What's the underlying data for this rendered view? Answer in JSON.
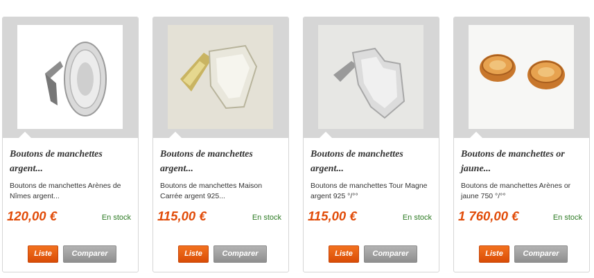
{
  "products": [
    {
      "title": "Boutons de manchettes argent...",
      "description": "Boutons de manchettes Arènes de Nîmes argent...",
      "price": "120,00 €",
      "stock": "En stock",
      "image": "silver-cufflink-arenes-image"
    },
    {
      "title": "Boutons de manchettes argent...",
      "description": "Boutons de manchettes Maison Carrée argent 925...",
      "price": "115,00 €",
      "stock": "En stock",
      "image": "silver-cufflink-maison-carree-image"
    },
    {
      "title": "Boutons de manchettes argent...",
      "description": "Boutons de manchettes Tour Magne argent 925 °/°°",
      "price": "115,00 €",
      "stock": "En stock",
      "image": "silver-cufflink-tour-magne-image"
    },
    {
      "title": "Boutons de manchettes or jaune...",
      "description": "Boutons de manchettes Arènes or jaune 750 °/°°",
      "price": "1 760,00 €",
      "stock": "En stock",
      "image": "gold-cufflinks-arenes-image"
    }
  ],
  "buttons": {
    "list_label": "Liste",
    "compare_label": "Comparer"
  },
  "colors": {
    "price": "#e14b08",
    "stock": "#2c7a23",
    "list_button": "#e8600f",
    "compare_button": "#a0a0a0"
  }
}
